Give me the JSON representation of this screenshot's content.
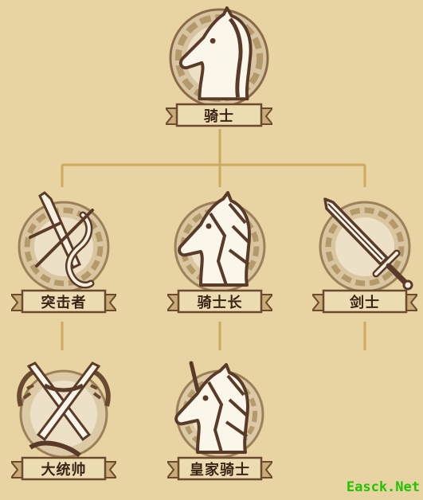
{
  "tree": {
    "root": {
      "label": "骑士",
      "icon": "horse-head-icon"
    },
    "tier2": [
      {
        "label": "突击者",
        "icon": "crossed-swords-icon"
      },
      {
        "label": "骑士长",
        "icon": "armored-horse-icon"
      },
      {
        "label": "剑士",
        "icon": "sword-icon"
      }
    ],
    "tier3": [
      {
        "label": "大统帅",
        "icon": "crossed-swords-laurel-icon"
      },
      {
        "label": "皇家骑士",
        "icon": "unicorn-knight-icon"
      }
    ]
  },
  "watermark": "Easck.Net",
  "colors": {
    "background": "#e8d3a3",
    "connector": "#cda95e",
    "ribbon": "#ecdcb2",
    "ribbon_edge": "#6d4a2e",
    "emblem_ring": "#b49a6a",
    "emblem_fill": "#e9dcc0",
    "emblem_dark": "#5a3a28",
    "watermark": "#22c400"
  }
}
